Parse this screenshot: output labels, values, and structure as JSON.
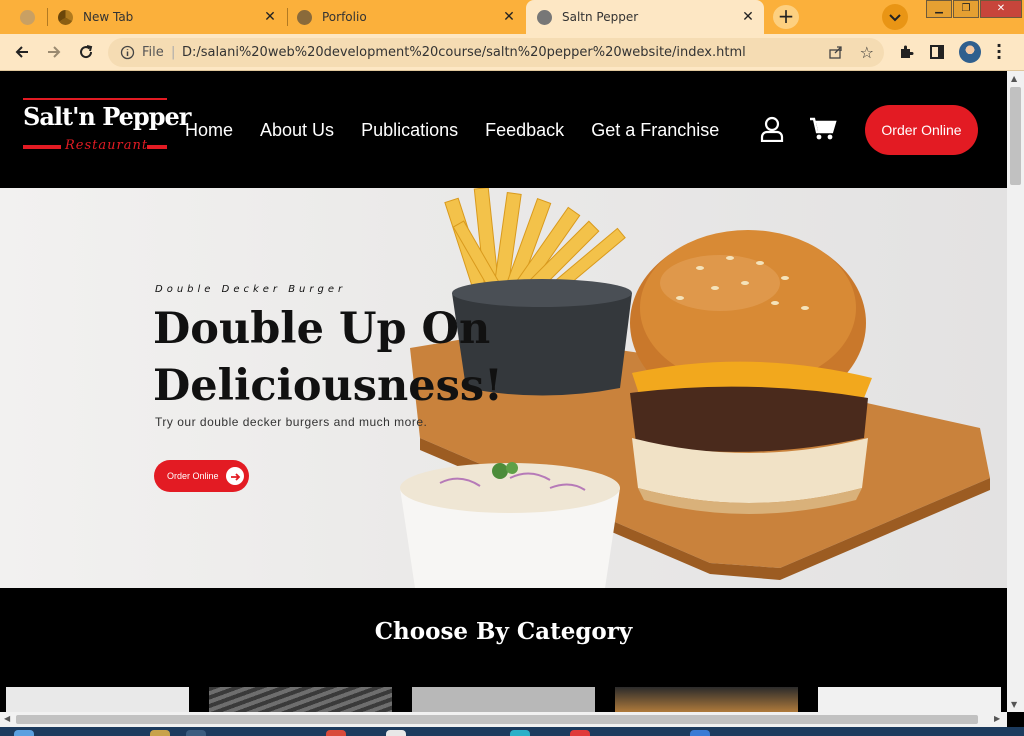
{
  "browser": {
    "tabs": [
      {
        "title": "",
        "state": "inactive"
      },
      {
        "title": "New Tab",
        "state": "inactive"
      },
      {
        "title": "Porfolio",
        "state": "inactive"
      },
      {
        "title": "Saltn Pepper",
        "state": "active"
      }
    ],
    "address": {
      "scheme_label": "File",
      "url": "D:/salani%20web%20development%20course/saltn%20pepper%20website/index.html"
    },
    "accent": "#fbb03b"
  },
  "site": {
    "logo": {
      "brand": "Salt'n Pepper",
      "sub": "Restaurant"
    },
    "nav": [
      "Home",
      "About Us",
      "Publications",
      "Feedback",
      "Get a Franchise"
    ],
    "order_button": "Order Online",
    "brand_color": "#e31b23"
  },
  "hero": {
    "eyebrow": "Double Decker Burger",
    "title_line1": "Double Up On",
    "title_line2": "Deliciousness!",
    "subtitle": "Try our double decker burgers and much more.",
    "button": "Order Online"
  },
  "category": {
    "title": "Choose By Category"
  }
}
